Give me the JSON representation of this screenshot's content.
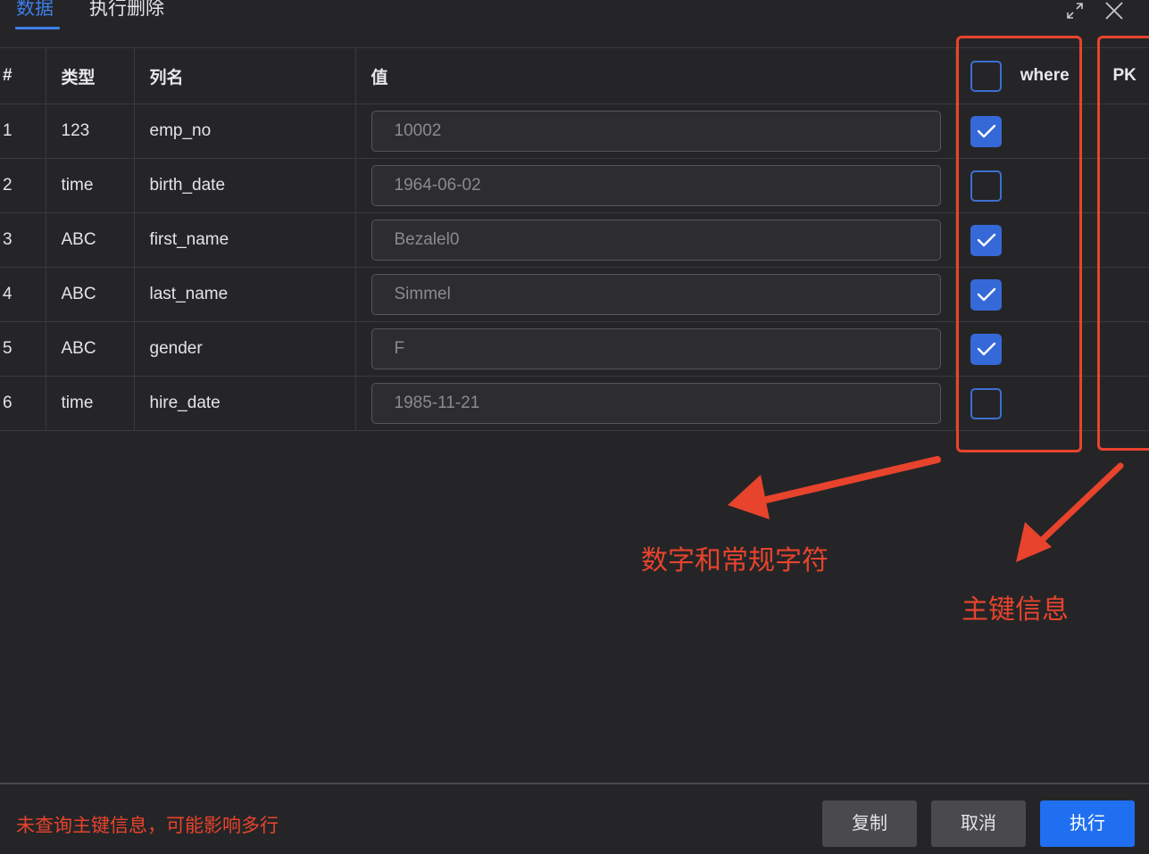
{
  "tabs": [
    {
      "label": "数据",
      "active": true
    },
    {
      "label": "执行删除",
      "active": false
    }
  ],
  "window_icons": [
    "expand-icon",
    "close-icon"
  ],
  "table": {
    "headers": {
      "index": "#",
      "type": "类型",
      "column": "列名",
      "value": "值",
      "where": "where",
      "pk": "PK"
    },
    "where_header_checked": false,
    "rows": [
      {
        "index": "1",
        "type": "123",
        "column": "emp_no",
        "value": "10002",
        "where": true
      },
      {
        "index": "2",
        "type": "time",
        "column": "birth_date",
        "value": "1964-06-02",
        "where": false
      },
      {
        "index": "3",
        "type": "ABC",
        "column": "first_name",
        "value": "Bezalel0",
        "where": true
      },
      {
        "index": "4",
        "type": "ABC",
        "column": "last_name",
        "value": "Simmel",
        "where": true
      },
      {
        "index": "5",
        "type": "ABC",
        "column": "gender",
        "value": "F",
        "where": true
      },
      {
        "index": "6",
        "type": "time",
        "column": "hire_date",
        "value": "1985-11-21",
        "where": false
      }
    ]
  },
  "annotations": {
    "where_note": "数字和常规字符",
    "pk_note": "主键信息",
    "color": "#e8432d"
  },
  "footer": {
    "message": "未查询主键信息，可能影响多行",
    "buttons": {
      "copy": "复制",
      "cancel": "取消",
      "execute": "执行"
    }
  },
  "colors": {
    "background": "#252527",
    "accent": "#3d7de8",
    "primary_button": "#1f6ff0",
    "warning": "#e8432d"
  }
}
